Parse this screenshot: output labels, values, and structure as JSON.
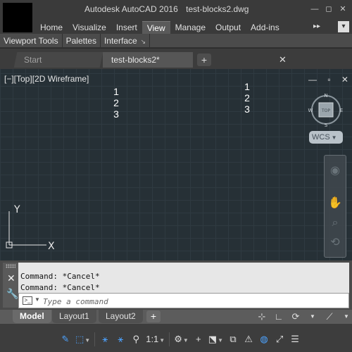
{
  "window": {
    "app_name": "Autodesk AutoCAD 2016",
    "file_name": "test-blocks2.dwg",
    "minimize_glyph": "—",
    "maximize_glyph": "◻",
    "close_glyph": "✕"
  },
  "ribbon": {
    "tabs": [
      "Home",
      "Visualize",
      "Insert",
      "View",
      "Manage",
      "Output",
      "Add-ins"
    ],
    "active_tab": "View",
    "more_glyph": "▸▸",
    "minimize_glyph": "▾",
    "panels": [
      "Viewport Tools",
      "Palettes",
      "Interface"
    ],
    "panel_expand_glyph": "↘"
  },
  "file_tabs": {
    "start_label": "Start",
    "doc_label": "test-blocks2*",
    "close_glyph": "✕",
    "add_glyph": "+"
  },
  "viewport": {
    "label": "[−][Top][2D Wireframe]",
    "controls": "— ▫ ✕",
    "text_block_a": [
      "1",
      "2",
      "3"
    ],
    "text_block_b": [
      "1",
      "2",
      "3"
    ],
    "viewcube_face": "TOP",
    "compass": {
      "n": "N",
      "s": "S",
      "e": "E",
      "w": "W"
    },
    "wcs_label": "WCS",
    "ucs": {
      "y_label": "Y",
      "x_label": "X"
    }
  },
  "command": {
    "history": [
      "Command: *Cancel*",
      "Command: *Cancel*"
    ],
    "placeholder": "Type a command"
  },
  "layout_tabs": {
    "tabs": [
      "Model",
      "Layout1",
      "Layout2"
    ],
    "active": "Model",
    "add_glyph": "+"
  },
  "status": {
    "annotation_scale": "1:1"
  },
  "colors": {
    "canvas_bg": "#263036",
    "accent_blue": "#4da3ff",
    "ui_dark": "#3a3a3a"
  },
  "icons": [
    "app-logo",
    "close-icon",
    "viewcube",
    "compass",
    "navigation-wheel-icon",
    "pan-icon",
    "zoom-icon",
    "orbit-icon",
    "ucs-icon",
    "grid-icon",
    "snap-icon",
    "ortho-icon",
    "polar-icon",
    "osnap-icon",
    "annotation-visibility-icon",
    "gear-icon",
    "plus-icon",
    "customize-icon"
  ]
}
